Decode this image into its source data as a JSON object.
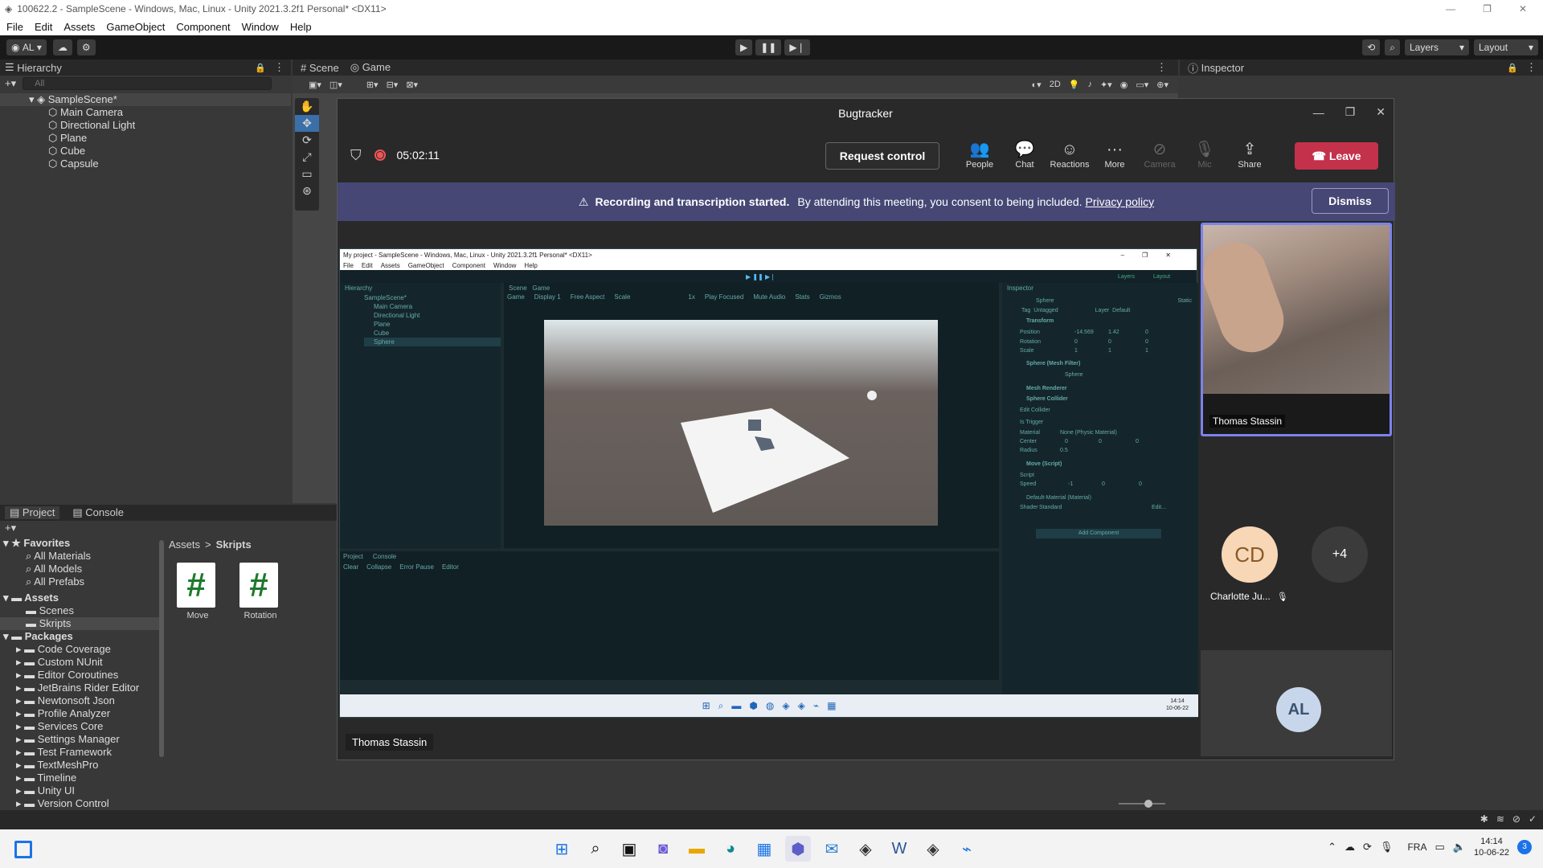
{
  "window": {
    "title": "100622.2 - SampleScene - Windows, Mac, Linux - Unity 2021.3.2f1 Personal* <DX11>"
  },
  "menu": [
    "File",
    "Edit",
    "Assets",
    "GameObject",
    "Component",
    "Window",
    "Help"
  ],
  "toolbar": {
    "account": "AL",
    "layers": "Layers",
    "layout": "Layout"
  },
  "hierarchy": {
    "tab": "Hierarchy",
    "search_placeholder": "All",
    "scene": "SampleScene*",
    "items": [
      "Main Camera",
      "Directional Light",
      "Plane",
      "Cube",
      "Capsule"
    ]
  },
  "scene_tabs": {
    "scene": "Scene",
    "game": "Game",
    "mode2d": "2D"
  },
  "inspector": {
    "tab": "Inspector"
  },
  "project": {
    "tabs": [
      "Project",
      "Console"
    ],
    "favorites_label": "Favorites",
    "favorites": [
      "All Materials",
      "All Models",
      "All Prefabs"
    ],
    "assets_label": "Assets",
    "assets": [
      "Scenes",
      "Skripts"
    ],
    "packages_label": "Packages",
    "packages": [
      "Code Coverage",
      "Custom NUnit",
      "Editor Coroutines",
      "JetBrains Rider Editor",
      "Newtonsoft Json",
      "Profile Analyzer",
      "Services Core",
      "Settings Manager",
      "Test Framework",
      "TextMeshPro",
      "Timeline",
      "Unity UI",
      "Version Control"
    ],
    "breadcrumb": [
      "Assets",
      "Skripts"
    ],
    "files": [
      {
        "name": "Move",
        "glyph": "#"
      },
      {
        "name": "Rotation",
        "glyph": "#"
      }
    ]
  },
  "teams": {
    "title": "Bugtracker",
    "timer": "05:02:11",
    "request_control": "Request control",
    "actions": [
      {
        "label": "People",
        "icon": "people-icon"
      },
      {
        "label": "Chat",
        "icon": "chat-icon"
      },
      {
        "label": "Reactions",
        "icon": "reactions-icon"
      },
      {
        "label": "More",
        "icon": "more-icon"
      },
      {
        "label": "Camera",
        "icon": "camera-off-icon"
      },
      {
        "label": "Mic",
        "icon": "mic-off-icon"
      },
      {
        "label": "Share",
        "icon": "share-icon"
      }
    ],
    "leave": "Leave",
    "banner_bold": "Recording and transcription started.",
    "banner_text": "By attending this meeting, you consent to being included.",
    "banner_link": "Privacy policy",
    "dismiss": "Dismiss",
    "presenter": "Thomas Stassin",
    "video_name": "Thomas Stassin",
    "participants": [
      {
        "initials": "CD",
        "name": "Charlotte Ju..."
      },
      {
        "initials": "+4",
        "name": ""
      }
    ],
    "self_initials": "AL"
  },
  "shared": {
    "title": "My project - SampleScene - Windows, Mac, Linux - Unity 2021.3.2f1 Personal* <DX11>",
    "menu": [
      "File",
      "Edit",
      "Assets",
      "GameObject",
      "Component",
      "Window",
      "Help"
    ],
    "hierarchy_items": [
      "SampleScene*",
      "Main Camera",
      "Directional Light",
      "Plane",
      "Cube",
      "Sphere"
    ],
    "game_bar": [
      "Game",
      "Display 1",
      "Free Aspect",
      "Scale",
      "1x",
      "Play Focused",
      "Mute Audio",
      "Stats",
      "Gizmos"
    ],
    "inspector_rows": [
      "Sphere",
      "Transform",
      "Position",
      "Rotation",
      "Scale",
      "Sphere (Mesh Filter)",
      "Mesh Renderer",
      "Sphere Collider",
      "Edit Collider",
      "Is Trigger",
      "Material",
      "Center",
      "Radius",
      "Move (Script)",
      "Script",
      "Speed",
      "Default-Material (Material)",
      "Add Component"
    ],
    "bottom": [
      "Project",
      "Console",
      "Clear",
      "Collapse",
      "Error Pause",
      "Editor"
    ],
    "clock": "14:14",
    "date": "10-06-22",
    "tag_label": "Tag",
    "tag_value": "Untagged",
    "layer_label": "Layer",
    "layer_value": "Default",
    "static": "Static",
    "pos_x": "-14.569",
    "pos_y": "1.42",
    "radius": "0.5",
    "speed_x": "-1",
    "zeros": "0",
    "ones": "1",
    "shared_layers": "Layers",
    "shared_layout": "Layout",
    "mesh": "Sphere",
    "material": "None (Physic Material)",
    "shader_label": "Shader",
    "shader_value": "Standard",
    "edit": "Edit..."
  },
  "taskbar": {
    "lang": "FRA",
    "time": "14:14",
    "date": "10-06-22",
    "badge": "3"
  }
}
